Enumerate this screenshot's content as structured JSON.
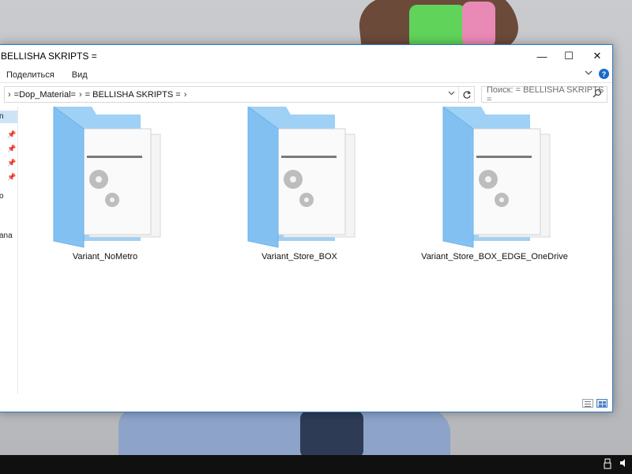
{
  "window": {
    "title": "BELLISHA SKRIPTS =",
    "controls": {
      "minimize": "—",
      "maximize": "☐",
      "close": "✕"
    }
  },
  "ribbon": {
    "tabs": [
      "Поделиться",
      "Вид"
    ],
    "expand_icon": "chevron-down-icon",
    "help_icon": "help-icon",
    "help_glyph": "?"
  },
  "address": {
    "crumbs": [
      "=Dop_Material=",
      "= BELLISHA SKRIPTS ="
    ],
    "separator": "›",
    "search_placeholder": "Поиск: = BELLISHA SKRIPTS ="
  },
  "nav": {
    "selected_label": "n",
    "labels": [
      "o",
      "ana"
    ]
  },
  "folders": [
    {
      "name": "Variant_NoMetro"
    },
    {
      "name": "Variant_Store_BOX"
    },
    {
      "name": "Variant_Store_BOX_EDGE_OneDrive"
    }
  ],
  "colors": {
    "accent": "#2b79c7",
    "folder_back": "#9fd0f5",
    "folder_front": "#7fbff0",
    "taskbar": "#101010"
  }
}
